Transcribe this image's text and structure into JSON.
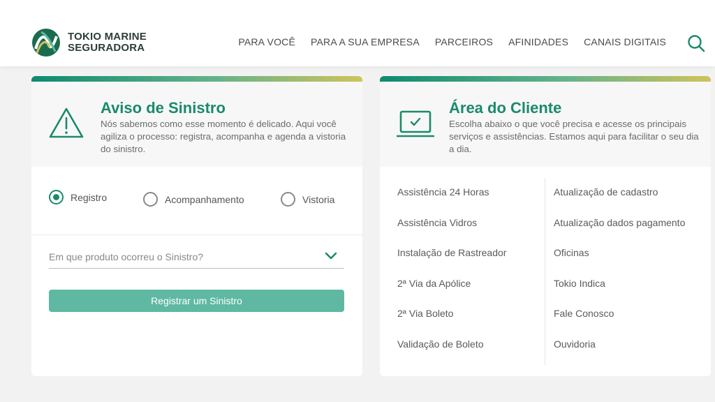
{
  "header": {
    "logo": {
      "line1": "TOKIO MARINE",
      "line2": "SEGURADORA"
    },
    "nav": [
      "PARA VOCÊ",
      "PARA A SUA EMPRESA",
      "PARCEIROS",
      "AFINIDADES",
      "CANAIS DIGITAIS"
    ],
    "icons": {
      "search": "search-icon"
    }
  },
  "colors": {
    "brand": "#1b8a6a",
    "button": "#5fb8a2",
    "accent_gold": "#cfc35a"
  },
  "sinistro": {
    "title": "Aviso de Sinistro",
    "description": "Nós sabemos como esse momento é delicado. Aqui você agiliza o processo: registra, acompanha e agenda a vistoria do sinistro.",
    "options": [
      "Registro",
      "Acompanhamento",
      "Vistoria"
    ],
    "selected": "Registro",
    "select_placeholder": "Em que produto ocorreu o Sinistro?",
    "button_label": "Registrar um Sinistro"
  },
  "cliente": {
    "title": "Área do Cliente",
    "description": "Escolha abaixo o que você precisa e acesse os principais serviços e assistências. Estamos aqui para facilitar o seu dia a dia.",
    "col1": [
      "Assistência 24 Horas",
      "Assistência Vidros",
      "Instalação de Rastreador",
      "2ª Via da Apólice",
      "2ª Via Boleto",
      "Validação de Boleto"
    ],
    "col2": [
      "Atualização de cadastro",
      "Atualização dados pagamento",
      "Oficinas",
      "Tokio Indica",
      "Fale Conosco",
      "Ouvidoria"
    ]
  }
}
